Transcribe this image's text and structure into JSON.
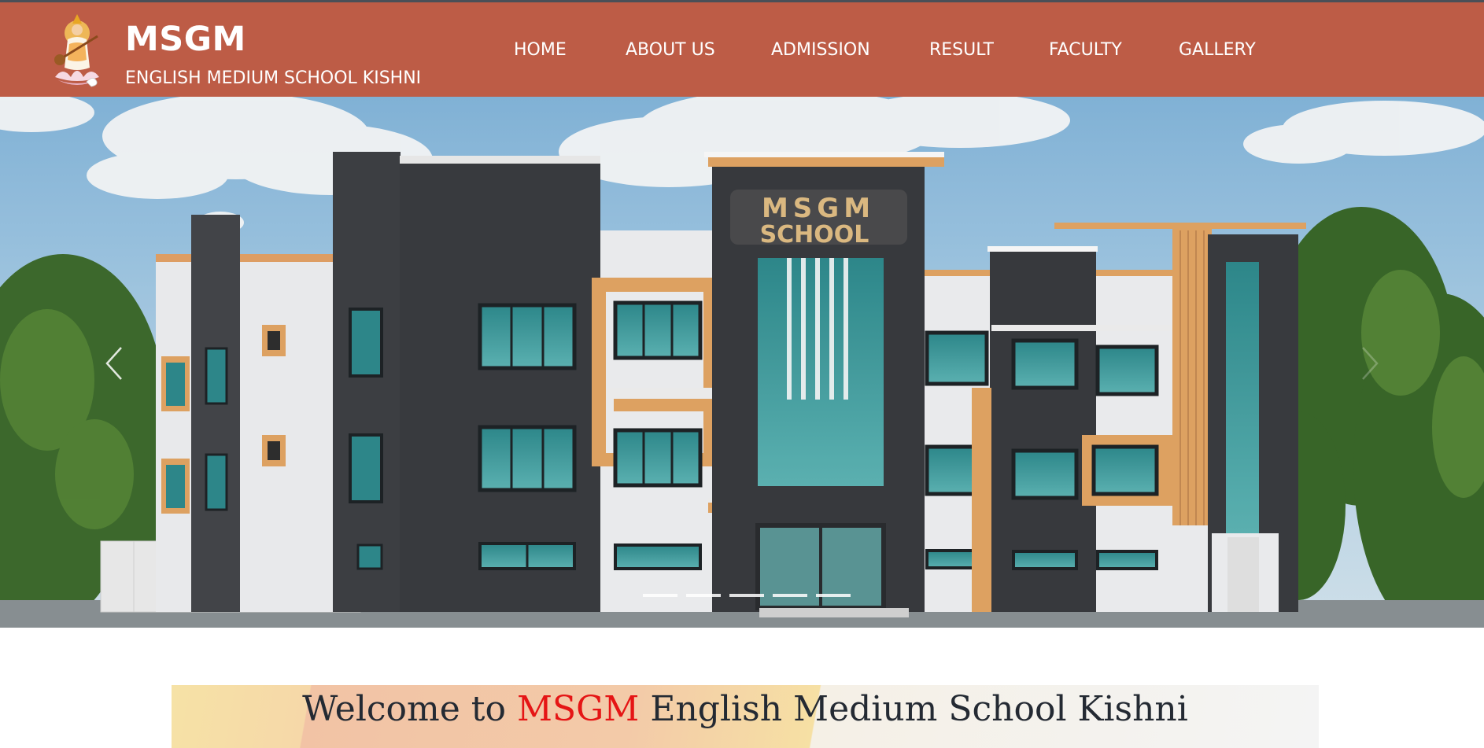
{
  "header": {
    "brand_title": "MSGM",
    "brand_subtitle": "ENGLISH MEDIUM SCHOOL KISHNI",
    "logo_icon": "saraswati-goddess-logo",
    "background_color": "#bd5c46"
  },
  "nav": {
    "items": [
      {
        "label": "HOME"
      },
      {
        "label": "ABOUT US"
      },
      {
        "label": "ADMISSION"
      },
      {
        "label": "RESULT"
      },
      {
        "label": "FACULTY"
      },
      {
        "label": "GALLERY"
      }
    ]
  },
  "hero": {
    "building_sign_line1": "MSGM",
    "building_sign_line2": "SCHOOL",
    "prev_icon": "chevron-left-icon",
    "next_icon": "chevron-right-icon",
    "slide_count": 5,
    "active_slide": 1
  },
  "welcome": {
    "title_prefix": "Welcome to ",
    "title_accent": "MSGM",
    "title_suffix": " English Medium School Kishni",
    "accent_color": "#e51515"
  }
}
